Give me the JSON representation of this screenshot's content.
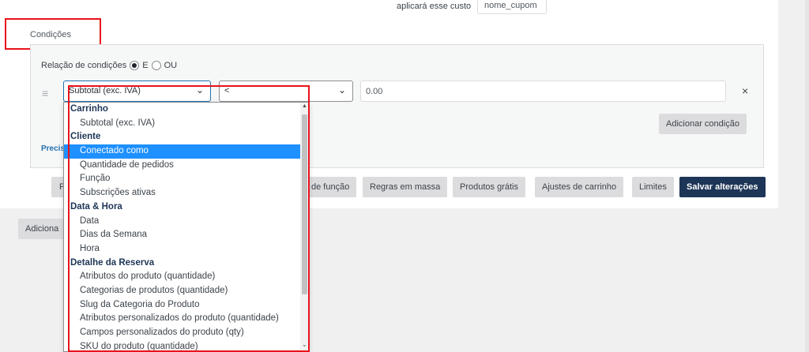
{
  "header": {
    "apply_label": "aplicará esse custo",
    "coupon_value": "nome_cupom"
  },
  "conditions": {
    "title": "Condições",
    "relation_label": "Relação de condições",
    "option_and": "E",
    "option_or": "OU",
    "type_selected": "Subtotal (exc. IVA)",
    "operator_selected": "<",
    "value": "0.00",
    "remove_icon": "×",
    "add_condition_label": "Adicionar condição",
    "precis_label": "Precis"
  },
  "dropdown": {
    "groups": [
      {
        "label": "Carrinho",
        "items": [
          "Subtotal (exc. IVA)"
        ]
      },
      {
        "label": "Cliente",
        "items": [
          "Conectado como",
          "Quantidade de pedidos",
          "Função",
          "Subscrições ativas"
        ]
      },
      {
        "label": "Data & Hora",
        "items": [
          "Data",
          "Dias da Semana",
          "Hora"
        ]
      },
      {
        "label": "Detalhe da Reserva",
        "items": [
          "Atributos do produto (quantidade)",
          "Categorias de produtos (quantidade)",
          "Slug da Categoria do Produto",
          "Atributos personalizados do produto (quantidade)",
          "Campos personalizados do produto (qty)",
          "SKU do produto (quantidade)"
        ]
      }
    ],
    "highlighted": "Conectado como"
  },
  "tabs": [
    {
      "label": "F"
    },
    {
      "label": "de função"
    },
    {
      "label": "Regras em massa"
    },
    {
      "label": "Produtos grátis"
    },
    {
      "label": "Ajustes de carrinho"
    },
    {
      "label": "Limites"
    },
    {
      "label": "Salvar alterações"
    }
  ],
  "footer": {
    "add_label": "Adiciona"
  },
  "colors": {
    "primary": "#1d3557",
    "highlight": "#1e90ff",
    "annotation": "#e8121b"
  }
}
